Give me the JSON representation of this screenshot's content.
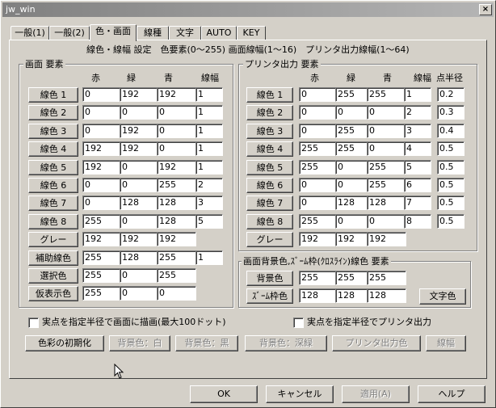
{
  "window": {
    "title": "jw_win",
    "close_symbol": "×"
  },
  "tabs": [
    "一般(1)",
    "一般(2)",
    "色・画面",
    "線種",
    "文字",
    "AUTO",
    "KEY"
  ],
  "info_line": "線色・線幅 設定　色要素(0～255)  画面線幅(1～16)　プリンタ出力線幅(1～64)",
  "screen": {
    "title": "画面 要素",
    "headers": [
      "赤",
      "緑",
      "青",
      "線幅"
    ],
    "rows": [
      {
        "label": "線色 1",
        "r": "0",
        "g": "192",
        "b": "192",
        "w": "1"
      },
      {
        "label": "線色 2",
        "r": "0",
        "g": "0",
        "b": "0",
        "w": "1"
      },
      {
        "label": "線色 3",
        "r": "0",
        "g": "192",
        "b": "0",
        "w": "1"
      },
      {
        "label": "線色 4",
        "r": "192",
        "g": "192",
        "b": "0",
        "w": "1"
      },
      {
        "label": "線色 5",
        "r": "192",
        "g": "0",
        "b": "192",
        "w": "1"
      },
      {
        "label": "線色 6",
        "r": "0",
        "g": "0",
        "b": "255",
        "w": "2"
      },
      {
        "label": "線色 7",
        "r": "0",
        "g": "128",
        "b": "128",
        "w": "3"
      },
      {
        "label": "線色 8",
        "r": "255",
        "g": "0",
        "b": "128",
        "w": "5"
      },
      {
        "label": "グレー",
        "r": "192",
        "g": "192",
        "b": "192",
        "w": ""
      },
      {
        "label": "補助線色",
        "r": "255",
        "g": "128",
        "b": "255",
        "w": "1"
      },
      {
        "label": "選択色",
        "r": "255",
        "g": "0",
        "b": "255",
        "w": ""
      },
      {
        "label": "仮表示色",
        "r": "255",
        "g": "0",
        "b": "0",
        "w": ""
      }
    ]
  },
  "printer": {
    "title": "プリンタ出力 要素",
    "headers": [
      "赤",
      "緑",
      "青",
      "線幅",
      "点半径"
    ],
    "rows": [
      {
        "label": "線色 1",
        "r": "0",
        "g": "255",
        "b": "255",
        "w": "1",
        "p": "0.2"
      },
      {
        "label": "線色 2",
        "r": "0",
        "g": "0",
        "b": "0",
        "w": "2",
        "p": "0.3"
      },
      {
        "label": "線色 3",
        "r": "0",
        "g": "255",
        "b": "0",
        "w": "3",
        "p": "0.4"
      },
      {
        "label": "線色 4",
        "r": "255",
        "g": "255",
        "b": "0",
        "w": "4",
        "p": "0.5"
      },
      {
        "label": "線色 5",
        "r": "255",
        "g": "0",
        "b": "255",
        "w": "5",
        "p": "0.5"
      },
      {
        "label": "線色 6",
        "r": "0",
        "g": "0",
        "b": "255",
        "w": "6",
        "p": "0.5"
      },
      {
        "label": "線色 7",
        "r": "0",
        "g": "128",
        "b": "128",
        "w": "7",
        "p": "0.5"
      },
      {
        "label": "線色 8",
        "r": "255",
        "g": "0",
        "b": "0",
        "w": "8",
        "p": "0.5"
      },
      {
        "label": "グレー",
        "r": "192",
        "g": "192",
        "b": "192",
        "w": "",
        "p": ""
      }
    ]
  },
  "background": {
    "title": "画面背景色,ｽﾞｰﾑ枠(ｸﾛｽﾗｲﾝ)線色 要素",
    "rows": [
      {
        "label": "背景色",
        "r": "255",
        "g": "255",
        "b": "255"
      },
      {
        "label": "ｽﾞｰﾑ枠色",
        "r": "128",
        "g": "128",
        "b": "128"
      }
    ],
    "text_color_button": "文字色"
  },
  "checkboxes": {
    "screen_point": "実点を指定半径で画面に描画(最大100ドット)",
    "printer_point": "実点を指定半径でプリンタ出力"
  },
  "bottom_buttons": {
    "init": "色彩の初期化",
    "bg_white": "背景色：白",
    "bg_black": "背景色：黒",
    "bg_dark_green": "背景色：深緑",
    "printer_color": "プリンタ出力色",
    "line_width": "線幅"
  },
  "dialog_buttons": {
    "ok": "OK",
    "cancel": "キャンセル",
    "apply": "適用(A)",
    "help": "ヘルプ"
  }
}
